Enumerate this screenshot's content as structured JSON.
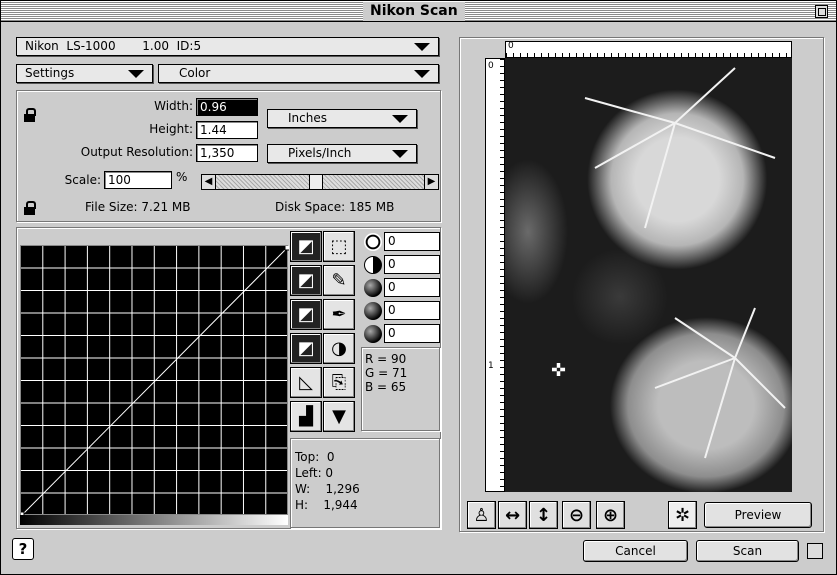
{
  "window": {
    "title": "Nikon Scan"
  },
  "scanner_select": {
    "value": "Nikon  LS-1000       1.00  ID:5"
  },
  "settings": {
    "label": "Settings",
    "color_mode": "Color"
  },
  "dimensions": {
    "width_label": "Width:",
    "width_value": "0.96",
    "height_label": "Height:",
    "height_value": "1.44",
    "resolution_label": "Output Resolution:",
    "resolution_value": "1,350",
    "unit": "Inches",
    "res_unit": "Pixels/Inch",
    "scale_label": "Scale:",
    "scale_value": "100",
    "scale_pct": "%",
    "file_size": "File Size: 7.21 MB",
    "disk_space": "Disk Space: 185 MB"
  },
  "adjustments": [
    {
      "icon": "brightness-icon",
      "value": "0"
    },
    {
      "icon": "contrast-icon",
      "value": "0"
    },
    {
      "icon": "red-balance-icon",
      "value": "0"
    },
    {
      "icon": "green-balance-icon",
      "value": "0"
    },
    {
      "icon": "blue-balance-icon",
      "value": "0"
    }
  ],
  "rgb": {
    "r": "R = 90",
    "g": "G = 71",
    "b": "B = 65"
  },
  "crop": {
    "top": "Top:  0",
    "left": "Left: 0",
    "w": "W:    1,296",
    "h": "H:    1,944"
  },
  "buttons": {
    "preview": "Preview",
    "cancel": "Cancel",
    "scan": "Scan"
  },
  "help": "?",
  "colors": {
    "window_bg": "#cccccc",
    "selected_field": "#000000"
  }
}
